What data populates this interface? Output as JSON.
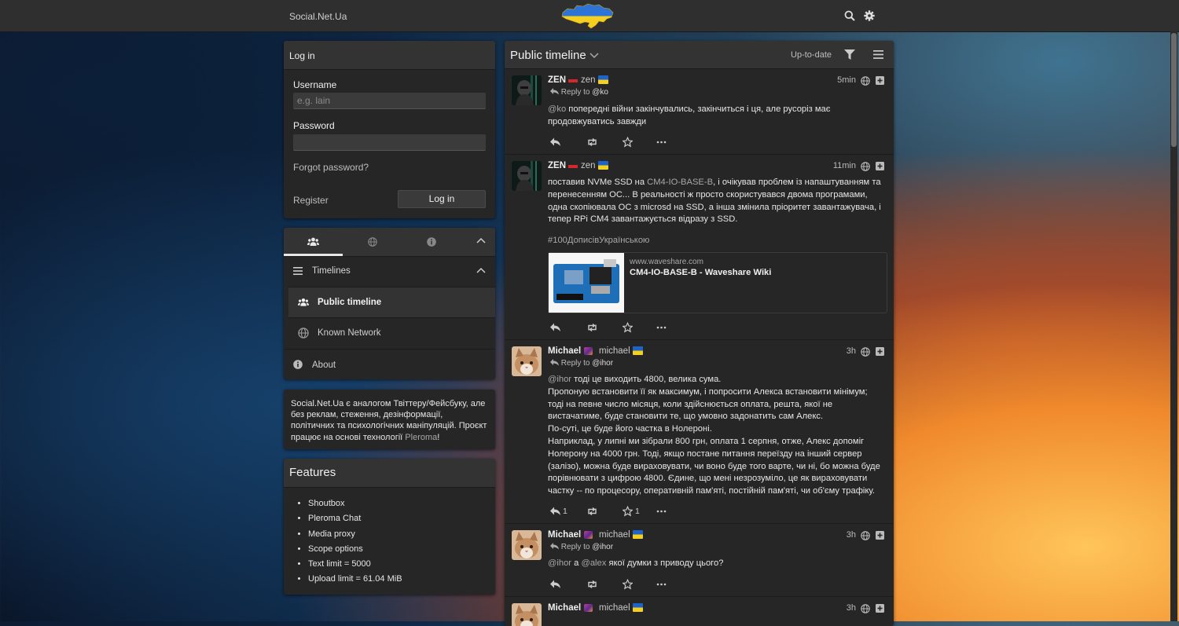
{
  "header": {
    "site_name": "Social.Net.Ua",
    "icons": [
      "search-icon",
      "gear-icon"
    ]
  },
  "login": {
    "title": "Log in",
    "username_label": "Username",
    "username_placeholder": "e.g. lain",
    "password_label": "Password",
    "forgot_password": "Forgot password?",
    "register": "Register",
    "login_button": "Log in"
  },
  "nav": {
    "tabs": [
      "users-icon",
      "globe-icon",
      "info-icon"
    ],
    "timelines_label": "Timelines",
    "items": [
      {
        "label": "Public timeline",
        "icon": "users-icon",
        "active": true
      },
      {
        "label": "Known Network",
        "icon": "globe-icon",
        "active": false
      }
    ],
    "about_label": "About"
  },
  "instance": {
    "description": "Social.Net.Ua є аналогом Твіттеру/Фейсбуку, але без реклам, стеження, дезінформації, політичних та психологічних маніпуляцій. Проєкт працює на основі технології",
    "link": "Pleroma",
    "suffix": "!"
  },
  "features": {
    "title": "Features",
    "items": [
      "Shoutbox",
      "Pleroma Chat",
      "Media proxy",
      "Scope options",
      "Text limit = 5000",
      "Upload limit = 61.04 MiB"
    ]
  },
  "timeline": {
    "title": "Public timeline",
    "status_label": "Up-to-date",
    "posts": [
      {
        "name": "ZEN",
        "handle": "zen",
        "time": "5min",
        "reply_label": "Reply to",
        "reply_to": "@ko",
        "mention": "@ko",
        "text": " попередні війни закінчувались, закінчиться і ця, але русоріз має продовжуватись завжди",
        "replies": "",
        "favs": ""
      },
      {
        "name": "ZEN",
        "handle": "zen",
        "time": "11min",
        "text_pre": "поставив NVMe SSD на ",
        "text_link": "CM4-IO-BASE-B",
        "text_post": ", і очікував проблем із напаштуванням та перенесенням ОС... В реальності ж просто скористувався двома програмами, одна скопіювала ОС з microsd на SSD, а інша змінила пріоритет завантажувача, і тепер RPi CM4 завантажується відразу з SSD.",
        "hashtag": "#100ДописівУкраїнською",
        "card": {
          "domain": "www.waveshare.com",
          "title": "CM4-IO-BASE-B - Waveshare Wiki"
        }
      },
      {
        "name": "Michael",
        "handle": "michael",
        "time": "3h",
        "reply_label": "Reply to",
        "reply_to": "@ihor",
        "lines": [
          {
            "mention": "@ihor",
            "text": " тоді це виходить 4800, велика сума."
          },
          {
            "mention": "",
            "text": "Пропоную встановити її як максимум, і попросити Алекса встановити мінімум; тоді на певне число місяця, коли здійснюється оплата, решта, якої не вистачатиме, буде становити те, що умовно задонатить сам Алекс."
          },
          {
            "mention": "",
            "text": "По-суті, це буде його частка в Нолероні."
          },
          {
            "mention": "",
            "text": "Наприклад, у липні ми зібрали 800 грн, оплата 1 серпня, отже, Алекс допоміг Нолерону на 4000 грн. Тоді, якщо постане питання переїзду на інший сервер (залізо), можна буде вираховувати, чи воно буде того варте, чи ні, бо можна буде порівнювати з цифрою 4800. Єдине, що мені незрозуміло, це як вираховувати частку -- по процесору, оперативній пам'яті, постійній пам'яті, чи об'єму трафіку."
          }
        ],
        "replies": "1",
        "favs": "1"
      },
      {
        "name": "Michael",
        "handle": "michael",
        "time": "3h",
        "reply_label": "Reply to",
        "reply_to": "@ihor",
        "mention1": "@ihor",
        "between": " а ",
        "mention2": "@alex",
        "text": " якої думки з приводу цього?"
      },
      {
        "name": "Michael",
        "handle": "michael",
        "time": "3h"
      }
    ]
  }
}
